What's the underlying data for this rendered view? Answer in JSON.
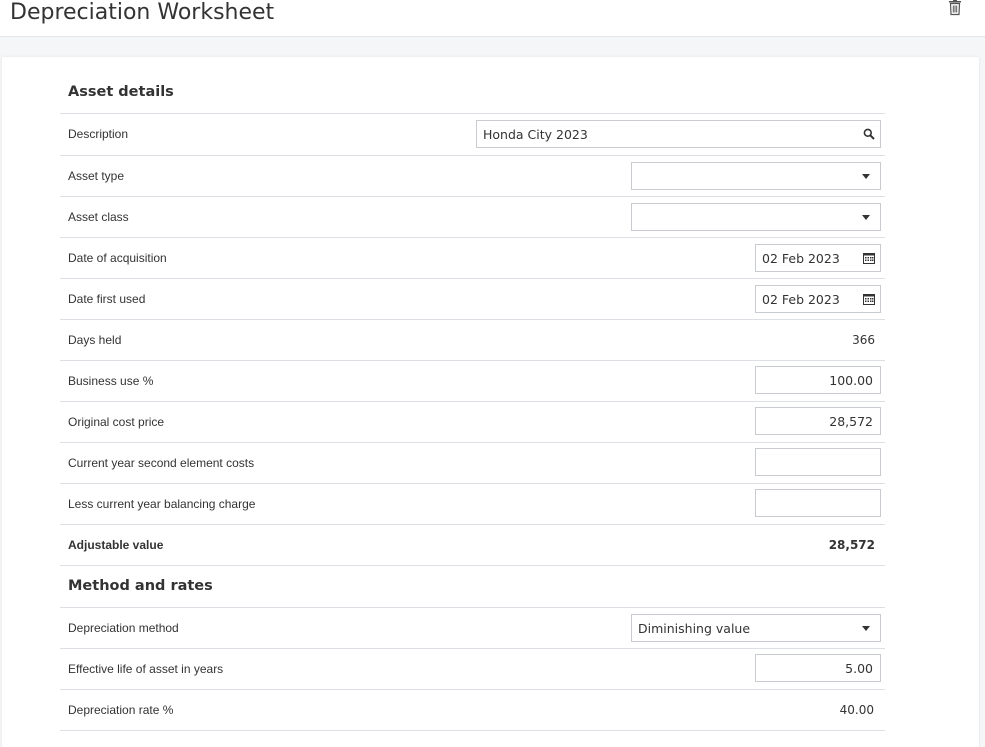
{
  "header": {
    "title": "Depreciation Worksheet",
    "delete_icon": "trash-icon"
  },
  "asset_details": {
    "heading": "Asset details",
    "description": {
      "label": "Description",
      "value": "Honda City 2023",
      "icon": "search-icon"
    },
    "asset_type": {
      "label": "Asset type",
      "value": "",
      "icon": "caret-down-icon"
    },
    "asset_class": {
      "label": "Asset class",
      "value": "",
      "icon": "caret-down-icon"
    },
    "date_of_acquisition": {
      "label": "Date of acquisition",
      "value": "02 Feb 2023",
      "icon": "calendar-icon"
    },
    "date_first_used": {
      "label": "Date first used",
      "value": "02 Feb 2023",
      "icon": "calendar-icon"
    },
    "days_held": {
      "label": "Days held",
      "value": "366"
    },
    "business_use": {
      "label": "Business use %",
      "value": "100.00"
    },
    "original_cost": {
      "label": "Original cost price",
      "value": "28,572"
    },
    "second_element_costs": {
      "label": "Current year second element costs",
      "value": ""
    },
    "balancing_charge": {
      "label": "Less current year balancing charge",
      "value": ""
    },
    "adjustable_value": {
      "label": "Adjustable value",
      "value": "28,572"
    }
  },
  "method_and_rates": {
    "heading": "Method and rates",
    "depreciation_method": {
      "label": "Depreciation method",
      "value": "Diminishing value",
      "icon": "caret-down-icon"
    },
    "effective_life": {
      "label": "Effective life of asset in years",
      "value": "5.00"
    },
    "depreciation_rate": {
      "label": "Depreciation rate %",
      "value": "40.00"
    }
  },
  "colors": {
    "border": "#c8ccd0",
    "divider": "#dcdfe3",
    "text": "#333333",
    "background": "#f5f6f8"
  }
}
